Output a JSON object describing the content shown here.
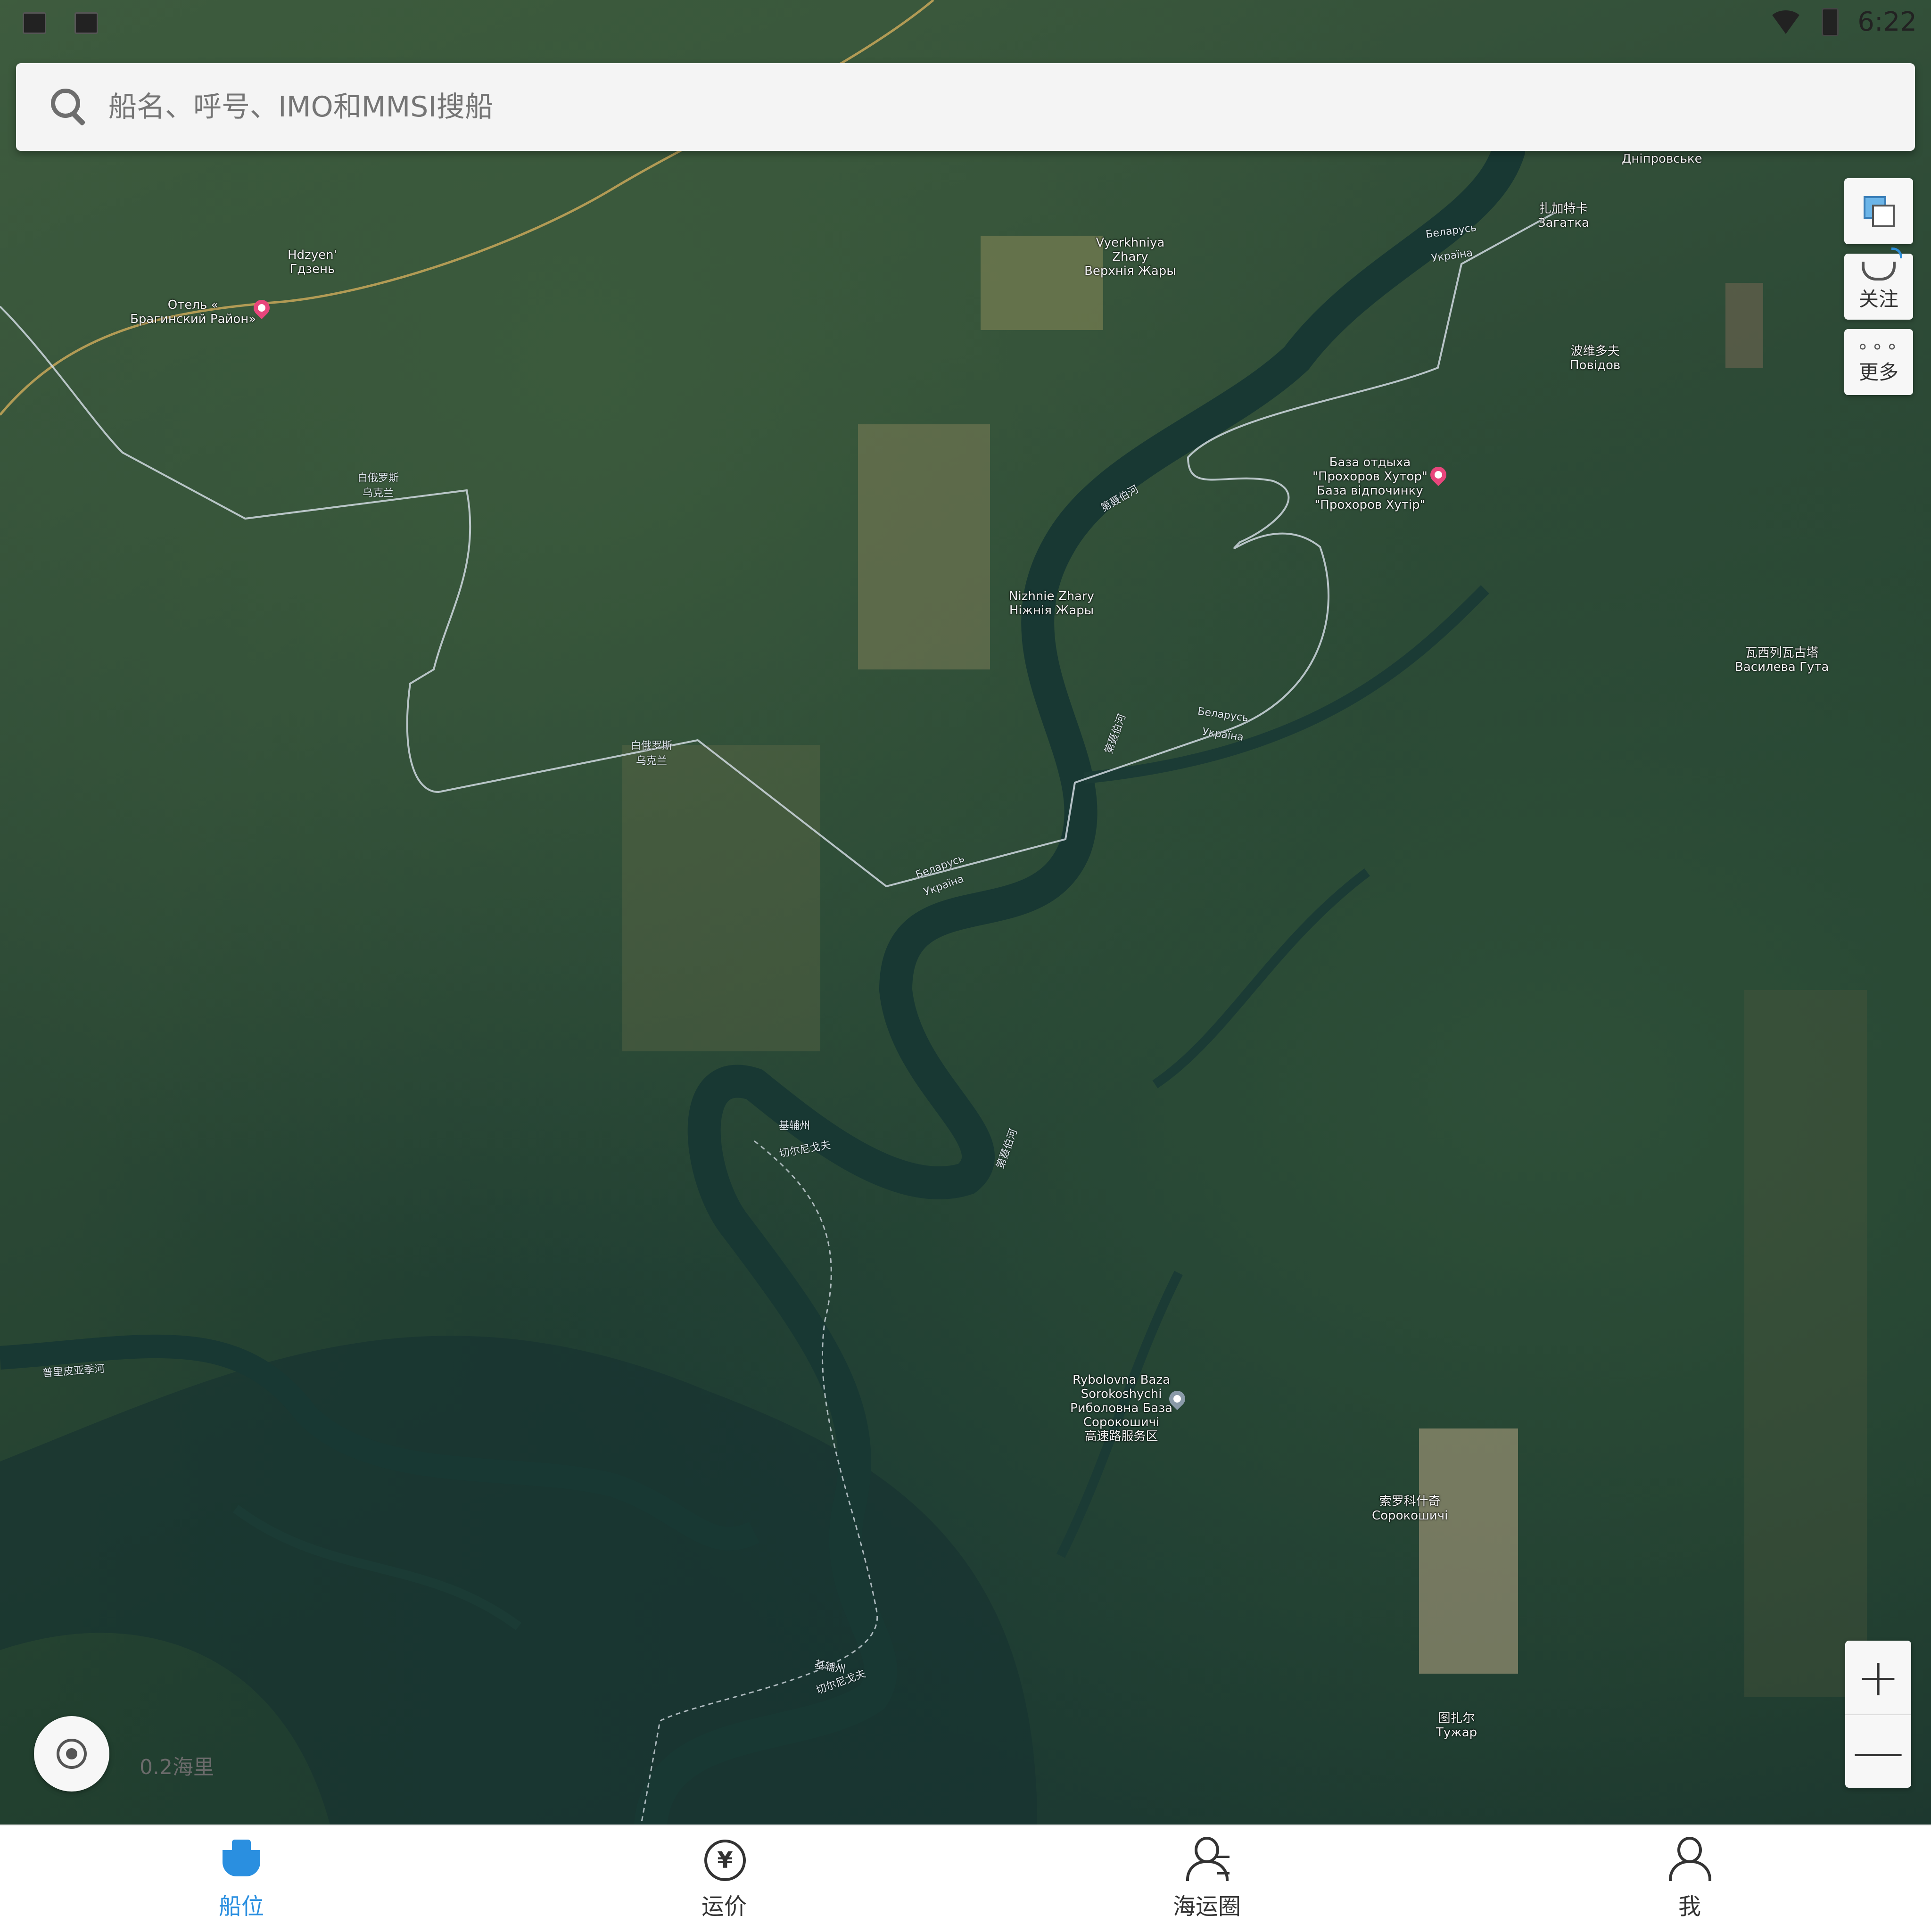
{
  "status_bar": {
    "time": "6:22",
    "icons": [
      "image-icon",
      "a-icon",
      "wifi-icon",
      "battery-icon"
    ]
  },
  "search": {
    "placeholder": "船名、呼号、IMO和MMSI搜船"
  },
  "map_controls": {
    "follow_label": "关注",
    "more_label": "更多",
    "zoom_in": "+",
    "zoom_out": "—",
    "scale": "0.2海里"
  },
  "map_labels": {
    "hdzyen": "Hdzyen'\nГдзень",
    "hotel": "Отель «\nБрагинский Район»",
    "vyerkhniya": "Vyerkhniya\nZhary\nВерхнія Жары",
    "dniprovske": "Дніпровське",
    "zahatka": "扎加特卡\nЗагатка",
    "povidov": "波维多夫\nПовідов",
    "prokhorov": "База отдыха\n\"Прохоров Хутор\"\nБаза відпочинку\n\"Прохоров Хутір\"",
    "nizhnie": "Nizhnie Zhary\nНіжнія Жары",
    "vasileva": "瓦西列瓦古塔\nВасилева Гута",
    "rybolovna": "Rybolovna Baza\nSorokoshychi\nРиболовна База\nСорокошичі\n高速路服务区",
    "sorokoshychi": "索罗科什奇\nСорокошичі",
    "tuzhar": "图扎尔\nТужар",
    "belarus_1": "Беларусь",
    "ukraine_1": "Україна",
    "belarus_2": "Беларусь",
    "ukraine_2": "Україна",
    "belarus_3": "Беларусь",
    "ukraine_3": "Україна",
    "border_cn_1": "白俄罗斯\n乌克兰",
    "border_cn_2": "白俄罗斯\n乌克兰",
    "kyiv_1": "基辅州",
    "chernihiv_1": "切尔尼戈夫",
    "kyiv_2": "基辅州",
    "chernihiv_2": "切尔尼戈夫",
    "pripyat": "普里皮亚季河",
    "dnipro_1": "第聂伯河",
    "dnipro_2": "第聂伯河",
    "dnipro_3": "第聂伯河"
  },
  "bottom_nav": [
    {
      "label": "船位",
      "icon": "ship-icon",
      "active": true
    },
    {
      "label": "运价",
      "icon": "yuan-icon",
      "active": false
    },
    {
      "label": "海运圈",
      "icon": "community-icon",
      "active": false
    },
    {
      "label": "我",
      "icon": "profile-icon",
      "active": false
    }
  ],
  "colors": {
    "accent": "#2a8fe0",
    "pin_pink": "#e8467c",
    "pin_gray": "#8a9aa8"
  }
}
